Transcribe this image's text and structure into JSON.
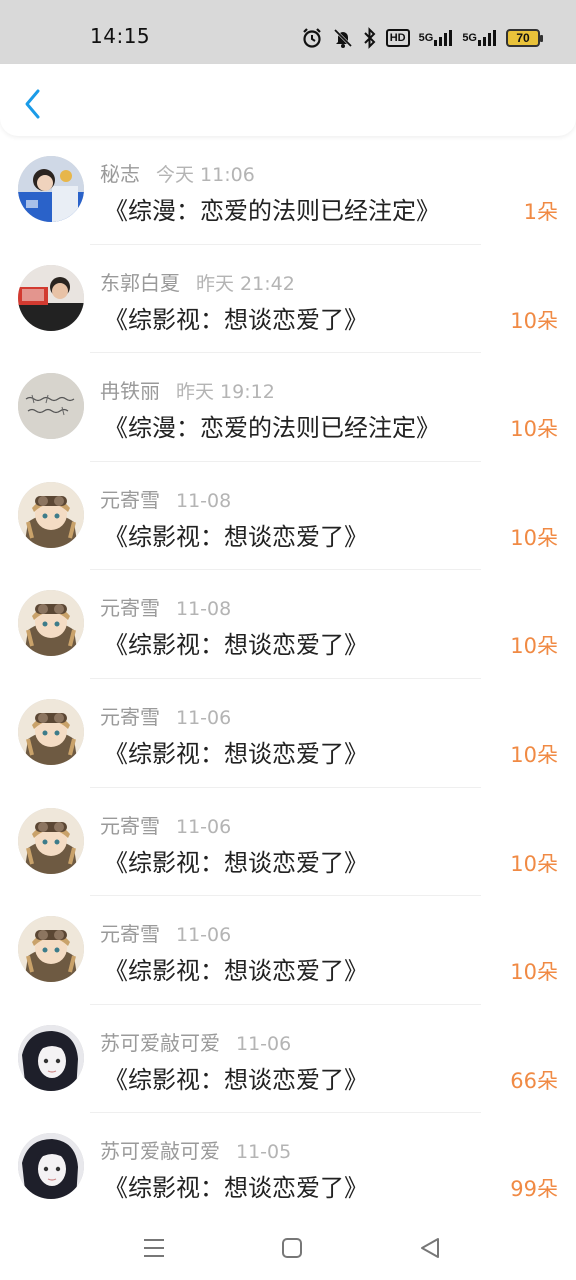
{
  "status_bar": {
    "time": "14:15",
    "hd": "HD",
    "net1": "5G",
    "net2": "5G",
    "battery": "70",
    "icons": [
      "alarm-icon",
      "mute-icon",
      "bluetooth-icon",
      "hd-icon",
      "signal-5g-icon",
      "signal-5g-icon",
      "battery-icon"
    ]
  },
  "header": {
    "back_icon": "chevron-left-icon",
    "accent": "#1a9be8"
  },
  "items": [
    {
      "name": "秘志",
      "time": "今天 11:06",
      "book": "《综漫：恋爱的法则已经注定》",
      "flowers": "1朵",
      "avatar": "photo-blue"
    },
    {
      "name": "东郭白夏",
      "time": "昨天 21:42",
      "book": "《综影视：想谈恋爱了》",
      "flowers": "10朵",
      "avatar": "photo-red"
    },
    {
      "name": "冉铁丽",
      "time": "昨天 19:12",
      "book": "《综漫：恋爱的法则已经注定》",
      "flowers": "10朵",
      "avatar": "handwriting"
    },
    {
      "name": "元寄雪",
      "time": "11-08",
      "book": "《综影视：想谈恋爱了》",
      "flowers": "10朵",
      "avatar": "anime-goggles"
    },
    {
      "name": "元寄雪",
      "time": "11-08",
      "book": "《综影视：想谈恋爱了》",
      "flowers": "10朵",
      "avatar": "anime-goggles"
    },
    {
      "name": "元寄雪",
      "time": "11-06",
      "book": "《综影视：想谈恋爱了》",
      "flowers": "10朵",
      "avatar": "anime-goggles"
    },
    {
      "name": "元寄雪",
      "time": "11-06",
      "book": "《综影视：想谈恋爱了》",
      "flowers": "10朵",
      "avatar": "anime-goggles"
    },
    {
      "name": "元寄雪",
      "time": "11-06",
      "book": "《综影视：想谈恋爱了》",
      "flowers": "10朵",
      "avatar": "anime-goggles"
    },
    {
      "name": "苏可爱敲可爱",
      "time": "11-06",
      "book": "《综影视：想谈恋爱了》",
      "flowers": "66朵",
      "avatar": "anime-dark"
    },
    {
      "name": "苏可爱敲可爱",
      "time": "11-05",
      "book": "《综影视：想谈恋爱了》",
      "flowers": "99朵",
      "avatar": "anime-dark"
    }
  ],
  "nav": {
    "icons": [
      "menu-icon",
      "home-icon",
      "back-triangle-icon"
    ]
  },
  "colors": {
    "flowers": "#f08a44",
    "name": "#9a9a9a",
    "title": "#222222"
  }
}
